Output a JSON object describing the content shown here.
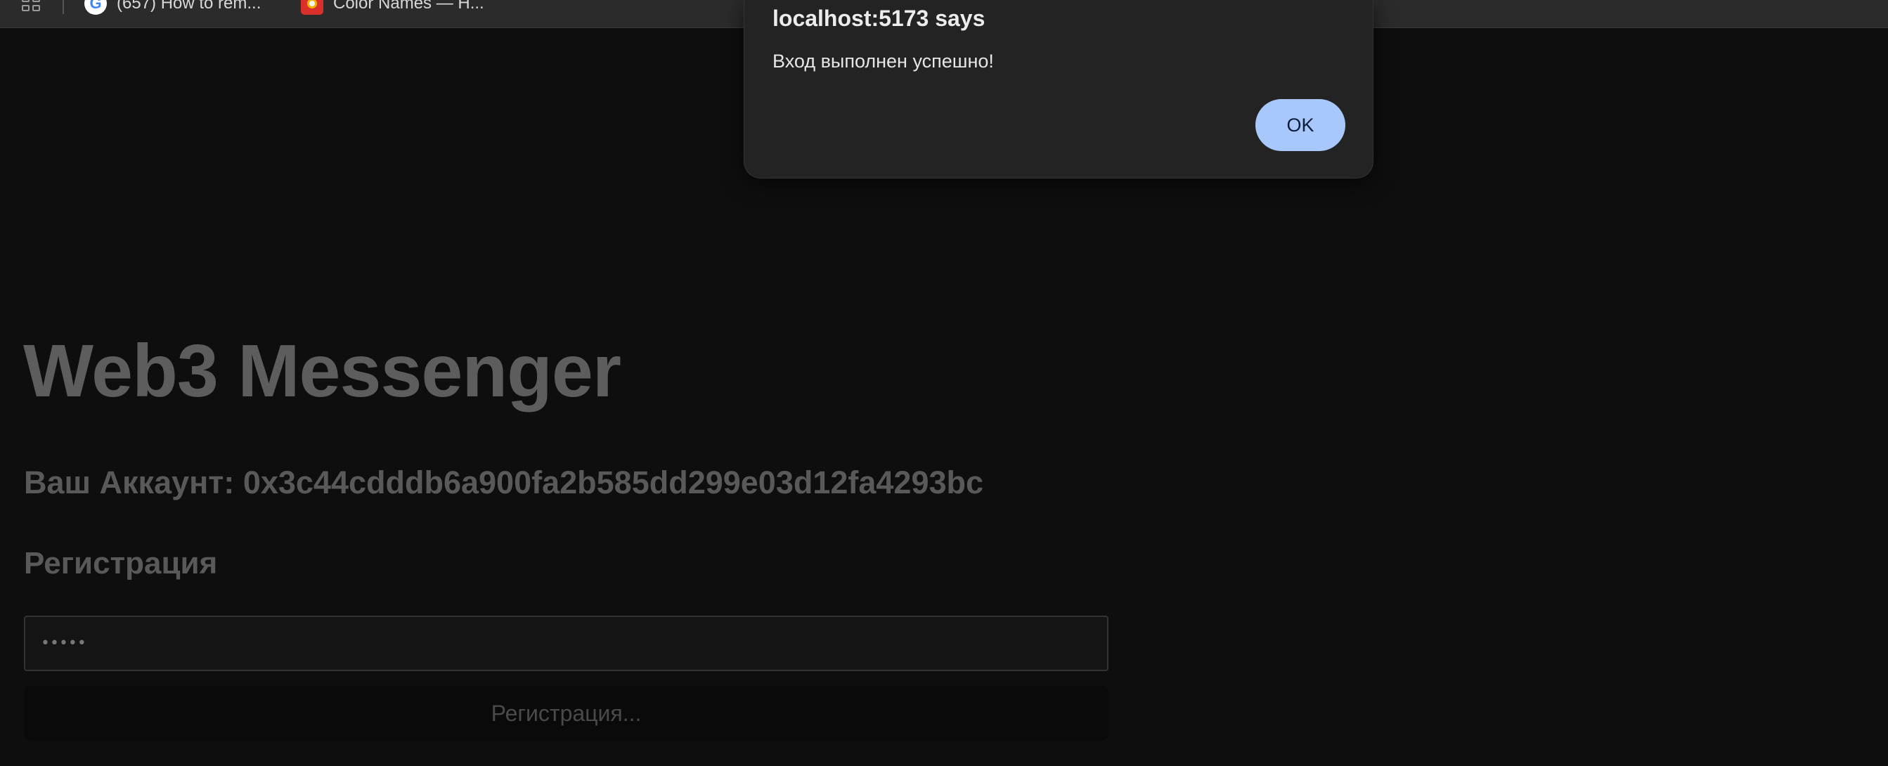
{
  "browser": {
    "bookmarks": [
      {
        "label": "(657) How to rem...",
        "icon": "google-favicon-icon"
      },
      {
        "label": "Color Names — H...",
        "icon": "color-names-favicon-icon"
      }
    ]
  },
  "page": {
    "title": "Web3 Messenger",
    "account_label": "Ваш Аккаунт: 0x3c44cdddb6a900fa2b585dd299e03d12fa4293bc",
    "section_heading": "Регистрация",
    "password_value": "•••••",
    "register_button_label": "Регистрация..."
  },
  "alert": {
    "title": "localhost:5173 says",
    "message": "Вход выполнен успешно!",
    "ok_label": "OK"
  },
  "colors": {
    "page_background": "#0e0e0e",
    "dialog_background": "#232323",
    "ok_button": "#a8c7fa"
  }
}
